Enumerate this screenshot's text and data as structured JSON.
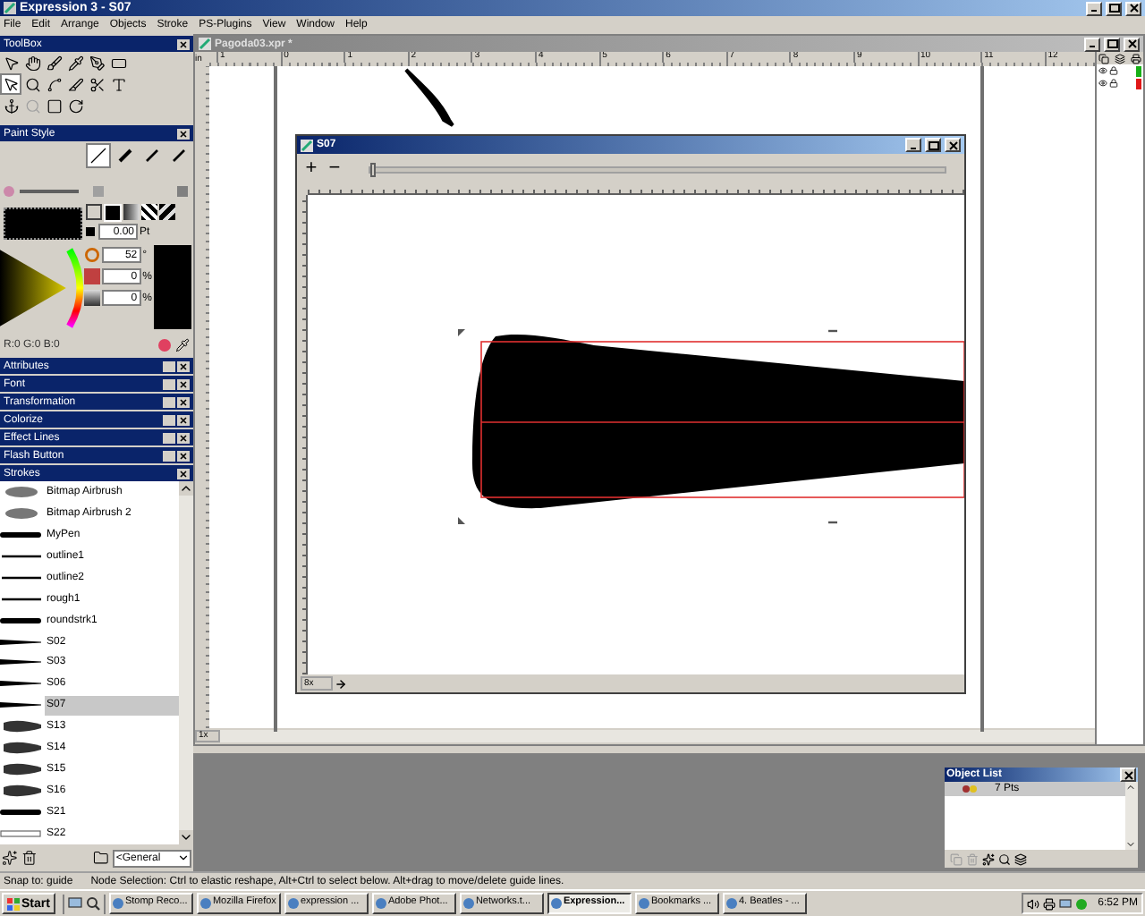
{
  "window": {
    "title": "Expression 3 - S07"
  },
  "menu": [
    "File",
    "Edit",
    "Arrange",
    "Objects",
    "Stroke",
    "PS-Plugins",
    "View",
    "Window",
    "Help"
  ],
  "toolbox": {
    "title": "ToolBox",
    "tools": [
      {
        "kind": "pointer",
        "selected": false,
        "disabled": false
      },
      {
        "kind": "hand",
        "selected": false,
        "disabled": false
      },
      {
        "kind": "brush",
        "selected": false,
        "disabled": false
      },
      {
        "kind": "dropper",
        "selected": false,
        "disabled": false
      },
      {
        "kind": "pen",
        "selected": false,
        "disabled": false
      },
      {
        "kind": "frame",
        "selected": false,
        "disabled": false
      },
      {
        "kind": "node",
        "selected": true,
        "disabled": false
      },
      {
        "kind": "zoom",
        "selected": false,
        "disabled": false
      },
      {
        "kind": "arch",
        "selected": false,
        "disabled": false
      },
      {
        "kind": "knife",
        "selected": false,
        "disabled": false
      },
      {
        "kind": "scissors",
        "selected": false,
        "disabled": false
      },
      {
        "kind": "text",
        "selected": false,
        "disabled": false
      },
      {
        "kind": "anchor",
        "selected": false,
        "disabled": false
      },
      {
        "kind": "zoom",
        "selected": false,
        "disabled": true
      },
      {
        "kind": "rectangle",
        "selected": false,
        "disabled": false
      },
      {
        "kind": "rotate",
        "selected": false,
        "disabled": false
      }
    ]
  },
  "paint_style": {
    "title": "Paint Style",
    "width_value": "0.00",
    "width_unit": "Pt",
    "hue_value": "52",
    "hue_unit": "°",
    "saturation_value": "0",
    "saturation_unit": "%",
    "brightness_value": "0",
    "brightness_unit": "%",
    "rgb": "R:0 G:0 B:0"
  },
  "collapsed_panels": [
    "Attributes",
    "Font",
    "Transformation",
    "Colorize",
    "Effect Lines",
    "Flash Button"
  ],
  "strokes": {
    "title": "Strokes",
    "category": "<General",
    "items": [
      {
        "name": "Bitmap Airbrush",
        "kind": "airbrush",
        "selected": false
      },
      {
        "name": "Bitmap Airbrush 2",
        "kind": "airbrush",
        "selected": false
      },
      {
        "name": "MyPen",
        "kind": "brush",
        "selected": false
      },
      {
        "name": "outline1",
        "kind": "line",
        "selected": false
      },
      {
        "name": "outline2",
        "kind": "line",
        "selected": false
      },
      {
        "name": "rough1",
        "kind": "line",
        "selected": false
      },
      {
        "name": "roundstrk1",
        "kind": "brush",
        "selected": false
      },
      {
        "name": "S02",
        "kind": "taper",
        "selected": false
      },
      {
        "name": "S03",
        "kind": "taper",
        "selected": false
      },
      {
        "name": "S06",
        "kind": "taper",
        "selected": false
      },
      {
        "name": "S07",
        "kind": "taper",
        "selected": true
      },
      {
        "name": "S13",
        "kind": "rough",
        "selected": false
      },
      {
        "name": "S14",
        "kind": "rough",
        "selected": false
      },
      {
        "name": "S15",
        "kind": "rough",
        "selected": false
      },
      {
        "name": "S16",
        "kind": "rough",
        "selected": false
      },
      {
        "name": "S21",
        "kind": "brush",
        "selected": false
      },
      {
        "name": "S22",
        "kind": "outline",
        "selected": false
      }
    ]
  },
  "document": {
    "title": "Pagoda03.xpr *",
    "ruler_unit": "in",
    "ruler_labels": [
      "1",
      "0",
      "1",
      "2",
      "3",
      "4",
      "5",
      "6",
      "7",
      "8",
      "9",
      "10",
      "11",
      "12"
    ],
    "zoom": "1x",
    "layers": [
      {
        "color": "#18b018"
      },
      {
        "color": "#e01818"
      }
    ]
  },
  "stroke_window": {
    "title": "S07",
    "zoom_in": "+",
    "zoom_out": "−",
    "level": 0.0,
    "zoom": "8x"
  },
  "object_list": {
    "title": "Object List",
    "items": [
      {
        "label": "7 Pts",
        "selected": true
      }
    ]
  },
  "status_bar": {
    "snap": "Snap to: guide",
    "hint": "Node Selection: Ctrl to elastic reshape, Alt+Ctrl to select below. Alt+drag to move/delete guide lines."
  },
  "taskbar": {
    "start": "Start",
    "tasks": [
      {
        "label": "Stomp Reco...",
        "selected": false
      },
      {
        "label": "Mozilla Firefox",
        "selected": false
      },
      {
        "label": "expression ...",
        "selected": false
      },
      {
        "label": "Adobe Phot...",
        "selected": false
      },
      {
        "label": "Networks.t...",
        "selected": false
      },
      {
        "label": "Expression...",
        "selected": true
      },
      {
        "label": "Bookmarks ...",
        "selected": false
      },
      {
        "label": "4. Beatles - ...",
        "selected": false
      }
    ],
    "clock": "6:52 PM"
  }
}
